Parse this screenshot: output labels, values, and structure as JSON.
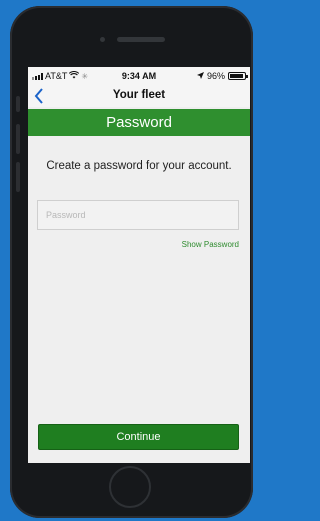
{
  "status_bar": {
    "carrier": "AT&T",
    "time": "9:34 AM",
    "battery_percent": "96%",
    "battery_level": 0.96
  },
  "nav": {
    "back_icon": "chevron-left-icon",
    "title": "Your fleet"
  },
  "header": {
    "title": "Password",
    "color": "#2f8f2f"
  },
  "form": {
    "prompt": "Create a password for your account.",
    "password_value": "",
    "password_placeholder": "Password",
    "show_password_label": "Show Password"
  },
  "actions": {
    "continue_label": "Continue",
    "continue_color": "#1f7e20"
  }
}
